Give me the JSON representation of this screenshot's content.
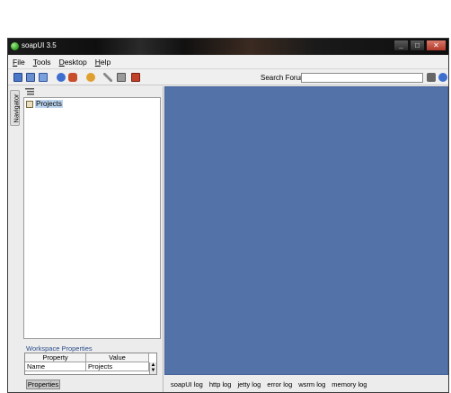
{
  "window": {
    "title": "soapUI 3.5",
    "controls": {
      "minimize": "_",
      "maximize": "□",
      "close": "✕"
    }
  },
  "menu": [
    {
      "key": "F",
      "rest": "ile"
    },
    {
      "key": "T",
      "rest": "ools"
    },
    {
      "key": "D",
      "rest": "esktop"
    },
    {
      "key": "H",
      "rest": "elp"
    }
  ],
  "toolbar": {
    "icons": [
      "new-project-icon",
      "import-icon",
      "save-all-icon",
      "help-icon",
      "plugin-icon",
      "monitor-icon",
      "tools-icon",
      "preferences-icon",
      "exit-icon"
    ],
    "search_label": "Search Forum",
    "search_value": "",
    "right_icons": [
      "search-go-icon",
      "info-icon"
    ]
  },
  "navigator": {
    "tab_label": "Navigator",
    "tree": {
      "root_label": "Projects"
    }
  },
  "workspace_properties": {
    "title": "Workspace Properties",
    "columns": [
      "Property",
      "Value"
    ],
    "rows": [
      {
        "property": "Name",
        "value": "Projects"
      }
    ],
    "button_label": "Properties"
  },
  "log_tabs": [
    "soapUI log",
    "http log",
    "jetty log",
    "error log",
    "wsrm log",
    "memory log"
  ],
  "colors": {
    "desktop_background": "#5372a8",
    "selection": "#bcd4ee",
    "titlebar": "#111111"
  }
}
